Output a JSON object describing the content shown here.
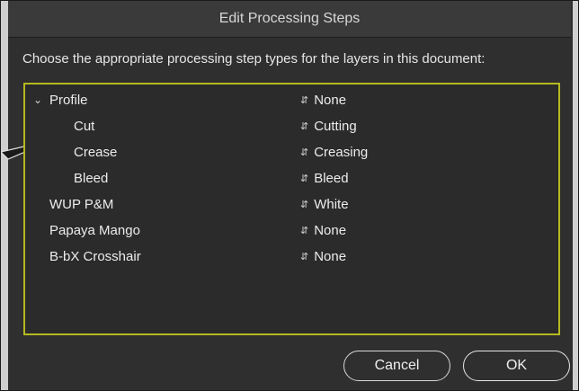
{
  "window": {
    "title": "Edit Processing Steps"
  },
  "prompt": "Choose the appropriate processing step types for the layers in this document:",
  "layers": [
    {
      "name": "Profile",
      "expanded": true,
      "step": "None"
    },
    {
      "name": "Cut",
      "step": "Cutting"
    },
    {
      "name": "Crease",
      "step": "Creasing"
    },
    {
      "name": "Bleed",
      "step": "Bleed"
    },
    {
      "name": "WUP P&M",
      "step": "White"
    },
    {
      "name": "Papaya Mango",
      "step": "None"
    },
    {
      "name": "B-bX Crosshair",
      "step": "None"
    }
  ],
  "icons": {
    "expand": "chevron-down-icon",
    "stepper": "up-down-arrows-icon"
  },
  "buttons": {
    "cancel": "Cancel",
    "ok": "OK"
  },
  "colors": {
    "focus_ring": "#b6ba1e",
    "background": "#2f2f2f"
  }
}
